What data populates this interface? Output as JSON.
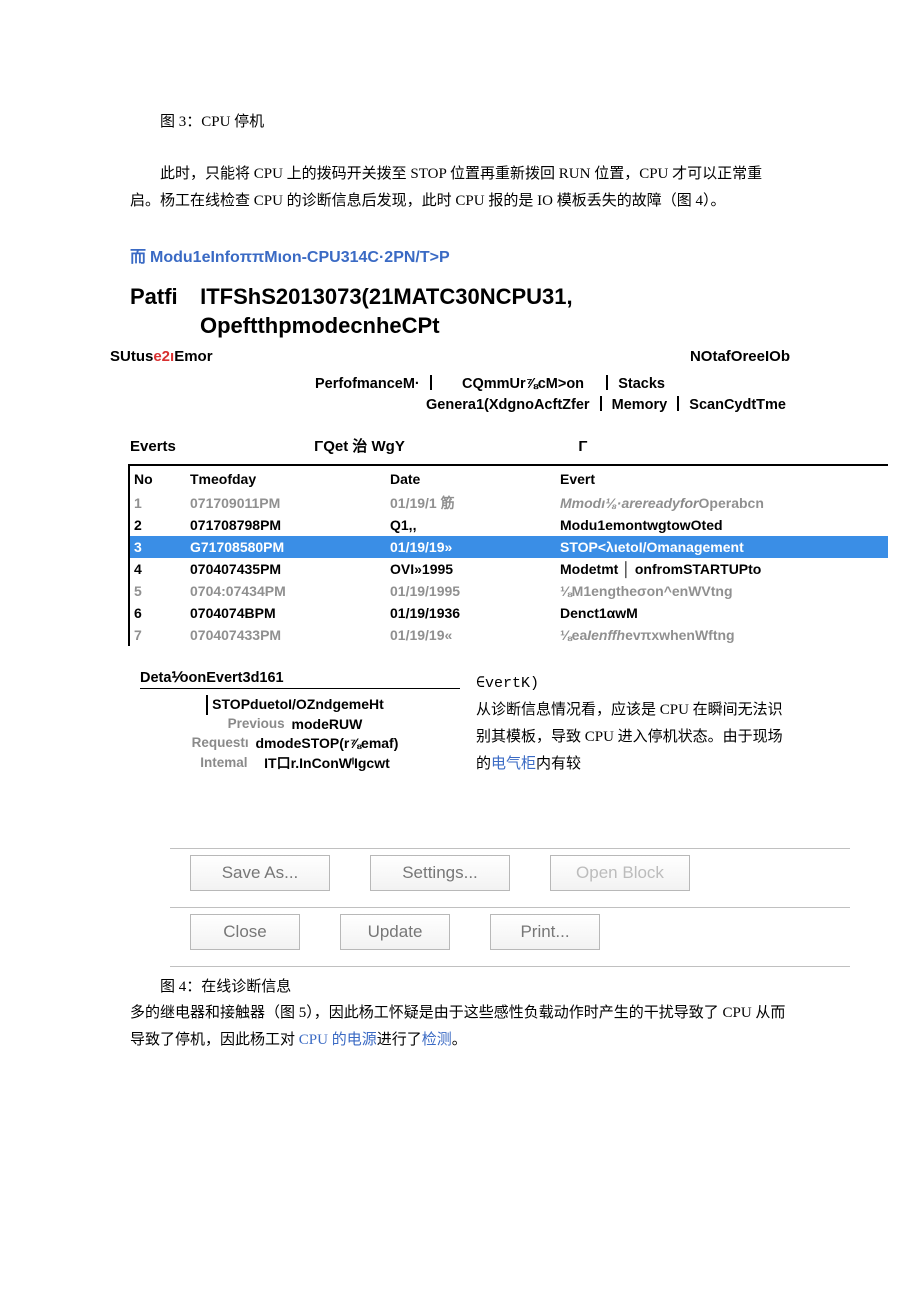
{
  "lead_caption": "图 3：CPU 停机",
  "para1": "此时，只能将 CPU 上的拨码开关拨至 STOP 位置再重新拨回 RUN 位置，CPU 才可以正常重启。杨工在线检查 CPU 的诊断信息后发现，此时 CPU 报的是 IO 模板丢失的故障（图 4）。",
  "module_title_glyph": "而",
  "module_title": "Modu1eInfoππMιon-CPU314C·2PN/T>P",
  "path_label": "Patfi",
  "path_line1": "ITFShS2013073(21MATC30NCPU31,",
  "path_line2": "OpeftthpmodecnheCPt",
  "status_left_pre": "SUtus",
  "status_left_red": "e2ı",
  "status_left_post": "Emor",
  "status_right": "NOtafOreeIOb",
  "tabs1_a": "PerfofmanceM·",
  "tabs1_b": "CQmmUr⅞cM>on",
  "tabs1_c": "Stacks",
  "tabs2_a": "Genera1(XdgnoAcftZfer",
  "tabs2_b": "Memory",
  "tabs2_c": "ScanCydtTme",
  "events_hdr_a": "Everts",
  "events_hdr_b": "ΓQet 治 WgY",
  "events_hdr_c": "Γ",
  "cols": {
    "no": "No",
    "time": "Tmeofday",
    "date": "Date",
    "ev": "Evert"
  },
  "rows": [
    {
      "no": "1",
      "time": "071709011PM",
      "date": "01/19/1 筋",
      "ev_pre": "M",
      "ev_mid": "modı⅛·areready",
      "ev_for": "for",
      "ev_post": "Operabcn",
      "style": "grey"
    },
    {
      "no": "2",
      "time": "071708798PM",
      "date": "Q1,,",
      "ev": "Modu1emontwgtowOted",
      "style": "bold"
    },
    {
      "no": "3",
      "time": "G71708580PM",
      "date": "01/19/19»",
      "ev": "STOP<λιetoI/Omanagement",
      "style": "selected"
    },
    {
      "no": "4",
      "time": "070407435PM",
      "date": "OVI»1995",
      "ev": "Modetmt │ onfromSTARTUPto",
      "style": "bold"
    },
    {
      "no": "5",
      "time": "0704:07434PM",
      "date": "01/19/1995",
      "ev": "⅛M1engtheσon^enWVtng",
      "style": "grey"
    },
    {
      "no": "6",
      "time": "0704074BPM",
      "date": "01/19/1936",
      "ev": "Denct1αwM",
      "style": "bold"
    },
    {
      "no": "7",
      "time": "070407433PM",
      "date": "01/19/19«",
      "ev_pre": "⅛ea",
      "ev_mid": "Ienffh",
      "ev_post": "evπxwhenWftng",
      "style": "grey"
    }
  ],
  "detail_header": "Deta⅟oonEvert3d161",
  "detail_line1": "STOPduetoI/OZndgemeHt",
  "detail_line2": "modeRUW",
  "detail_line3": "dmodeSTOP(r⅞emaf)",
  "detail_line4": "IT口r.InConWˡIgcwt",
  "side_prev": "Previous",
  "side_req": "Requestı",
  "side_int": "Intemal",
  "right_top": "∈vertK)",
  "right_para_a": "从诊断信息情况看，应该是 CPU 在瞬间无法识别其模板，导致 CPU 进入停机状态。由于现场的",
  "right_link": "电气柜",
  "right_para_b": "内有较",
  "buttons": {
    "save": "Save As...",
    "settings": "Settings...",
    "open": "Open Block",
    "close": "Close",
    "update": "Update",
    "print": "Print..."
  },
  "caption2": "图 4：在线诊断信息",
  "after_a": "多的继电器和接触器（图 5），因此杨工怀疑是由于这些感性负载动作时产生的干扰导致了 CPU 从而导致了停机，因此杨工对 ",
  "after_link1": "CPU 的电源",
  "after_mid": "进行了",
  "after_link2": "检测",
  "after_end": "。"
}
